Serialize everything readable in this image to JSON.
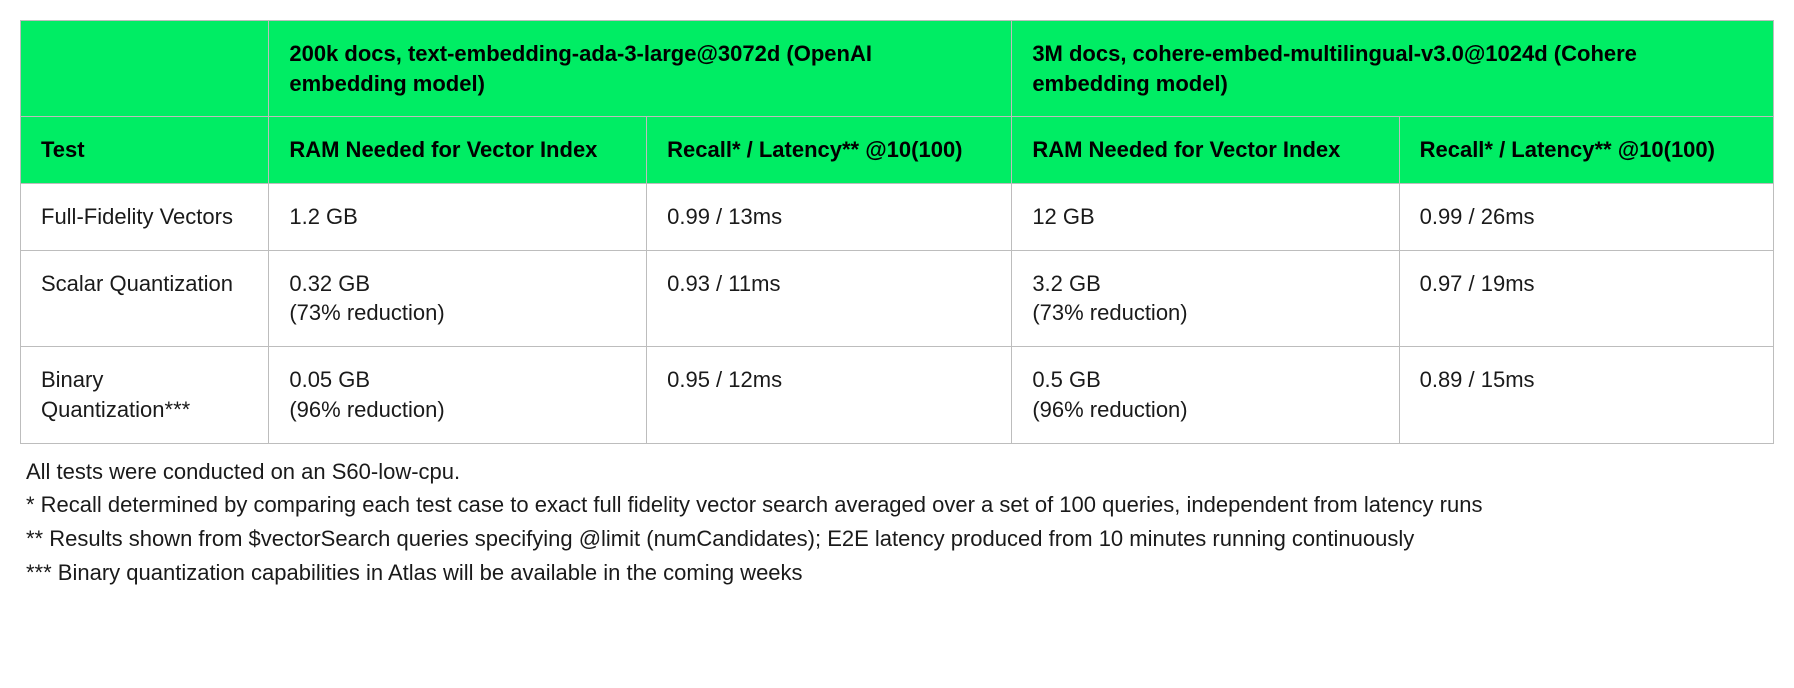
{
  "table": {
    "header_row1": {
      "blank": "",
      "group1": "200k docs, text-embedding-ada-3-large@3072d (OpenAI embedding model)",
      "group2": "3M docs, cohere-embed-multilingual-v3.0@1024d (Cohere embedding model)"
    },
    "header_row2": {
      "test": "Test",
      "ram1": "RAM Needed for Vector Index",
      "recall1": "Recall* / Latency** @10(100)",
      "ram2": "RAM Needed for Vector Index",
      "recall2": "Recall* / Latency** @10(100)"
    },
    "rows": [
      {
        "test": "Full-Fidelity Vectors",
        "ram1": "1.2 GB",
        "recall1": "0.99 / 13ms",
        "ram2": "12 GB",
        "recall2": "0.99 / 26ms"
      },
      {
        "test": "Scalar Quantization",
        "ram1": "0.32 GB\n(73% reduction)",
        "recall1": "0.93 / 11ms",
        "ram2": "3.2 GB\n(73% reduction)",
        "recall2": "0.97 / 19ms"
      },
      {
        "test": "Binary Quantization***",
        "ram1": "0.05 GB\n(96% reduction)",
        "recall1": "0.95 / 12ms",
        "ram2": "0.5 GB\n(96% reduction)",
        "recall2": "0.89 / 15ms"
      }
    ]
  },
  "footnotes": {
    "l1": "All tests were conducted on an S60-low-cpu.",
    "l2": "* Recall determined by comparing each test case to exact full fidelity vector search averaged over a set of 100 queries, independent from latency runs",
    "l3": "** Results shown from $vectorSearch queries specifying @limit (numCandidates); E2E latency produced from 10 minutes running continuously",
    "l4": "*** Binary quantization capabilities in Atlas will be available in the coming weeks"
  }
}
